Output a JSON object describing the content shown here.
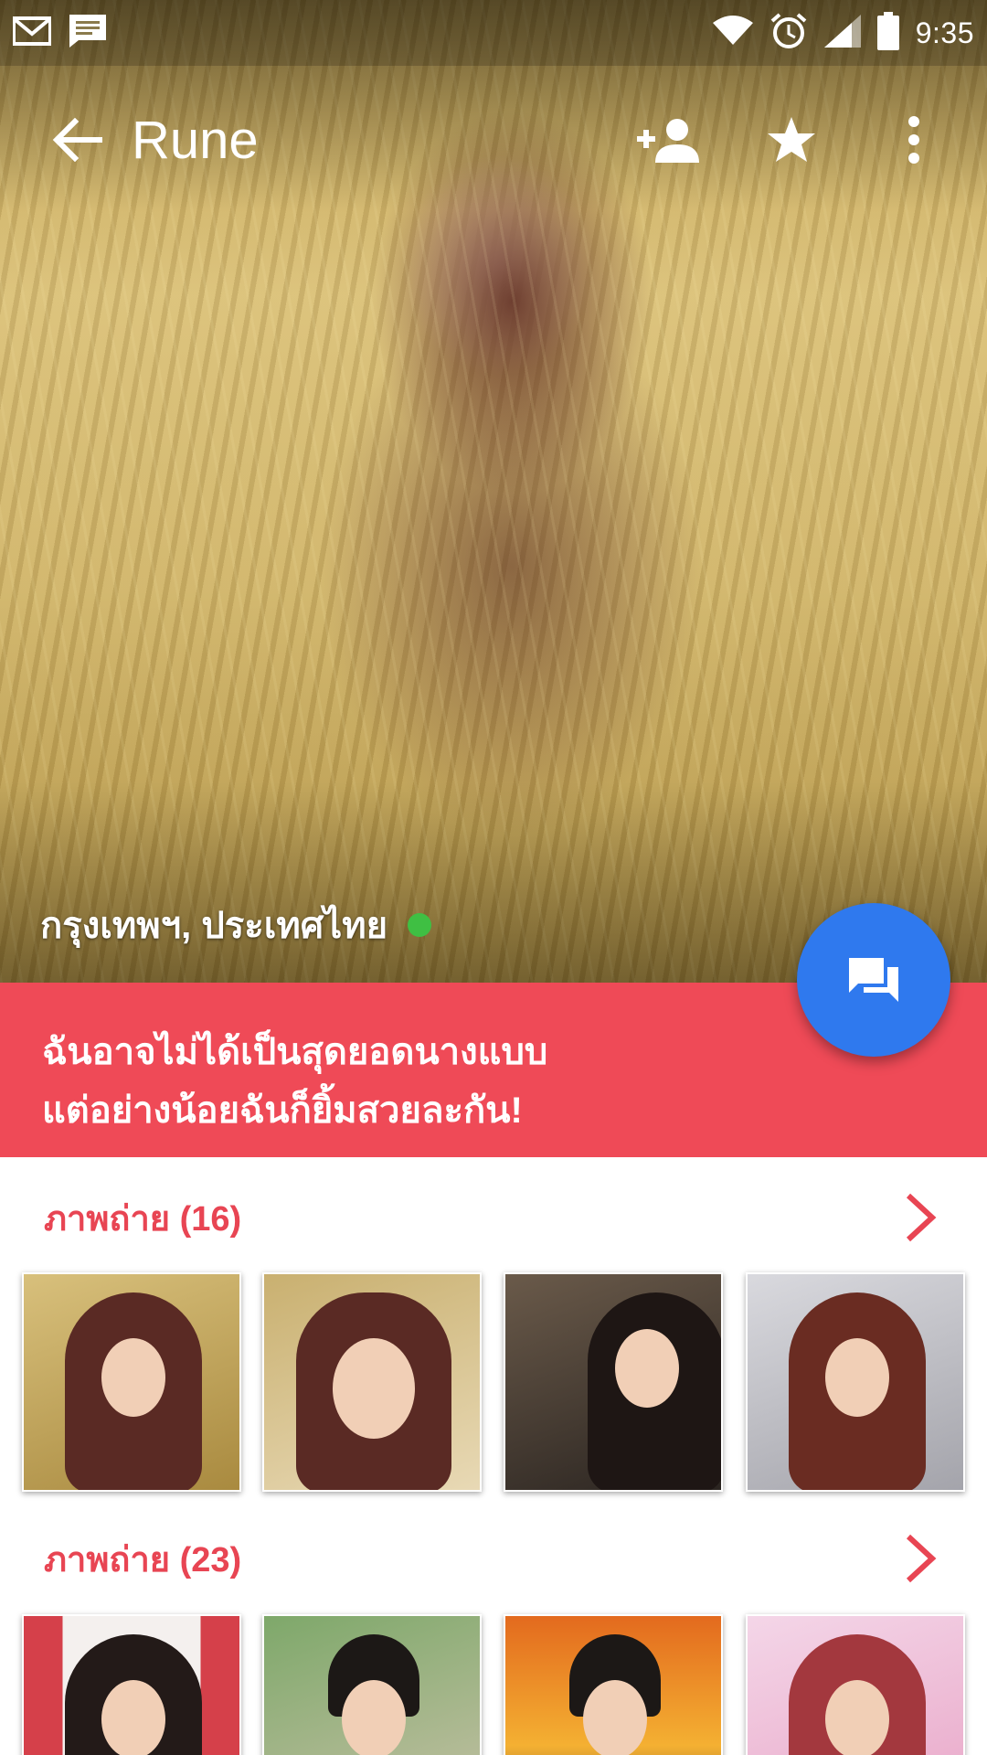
{
  "status_bar": {
    "time": "9:35",
    "left_icons": [
      "gmail-icon",
      "message-icon"
    ],
    "right_icons": [
      "wifi-icon",
      "alarm-icon",
      "signal-icon",
      "battery-icon"
    ]
  },
  "toolbar": {
    "title": "Rune",
    "actions": [
      "add-contact-icon",
      "star-icon",
      "more-vert-icon"
    ]
  },
  "profile": {
    "location": "กรุงเทพฯ, ประเทศไทย",
    "online": true,
    "quote_line1": "ฉันอาจไม่ได้เป็นสุดยอดนางแบบ",
    "quote_line2": "แต่อย่างน้อยฉันก็ยิ้มสวยละกัน!"
  },
  "sections": [
    {
      "title": "ภาพถ่าย (16)",
      "thumbs": [
        "wheat-field-portrait",
        "close-up-smile",
        "christmas-portrait",
        "red-top-portrait"
      ]
    },
    {
      "title": "ภาพถ่าย (23)",
      "thumbs": [
        "traditional-dress-portrait",
        "young-man-portrait",
        "man-industrial-sunset",
        "pink-costume-portrait"
      ]
    }
  ],
  "colors": {
    "accent_red": "#ef4a57",
    "section_red": "#e84553",
    "fab_blue": "#2f79ee",
    "online_green": "#3fbf43"
  }
}
